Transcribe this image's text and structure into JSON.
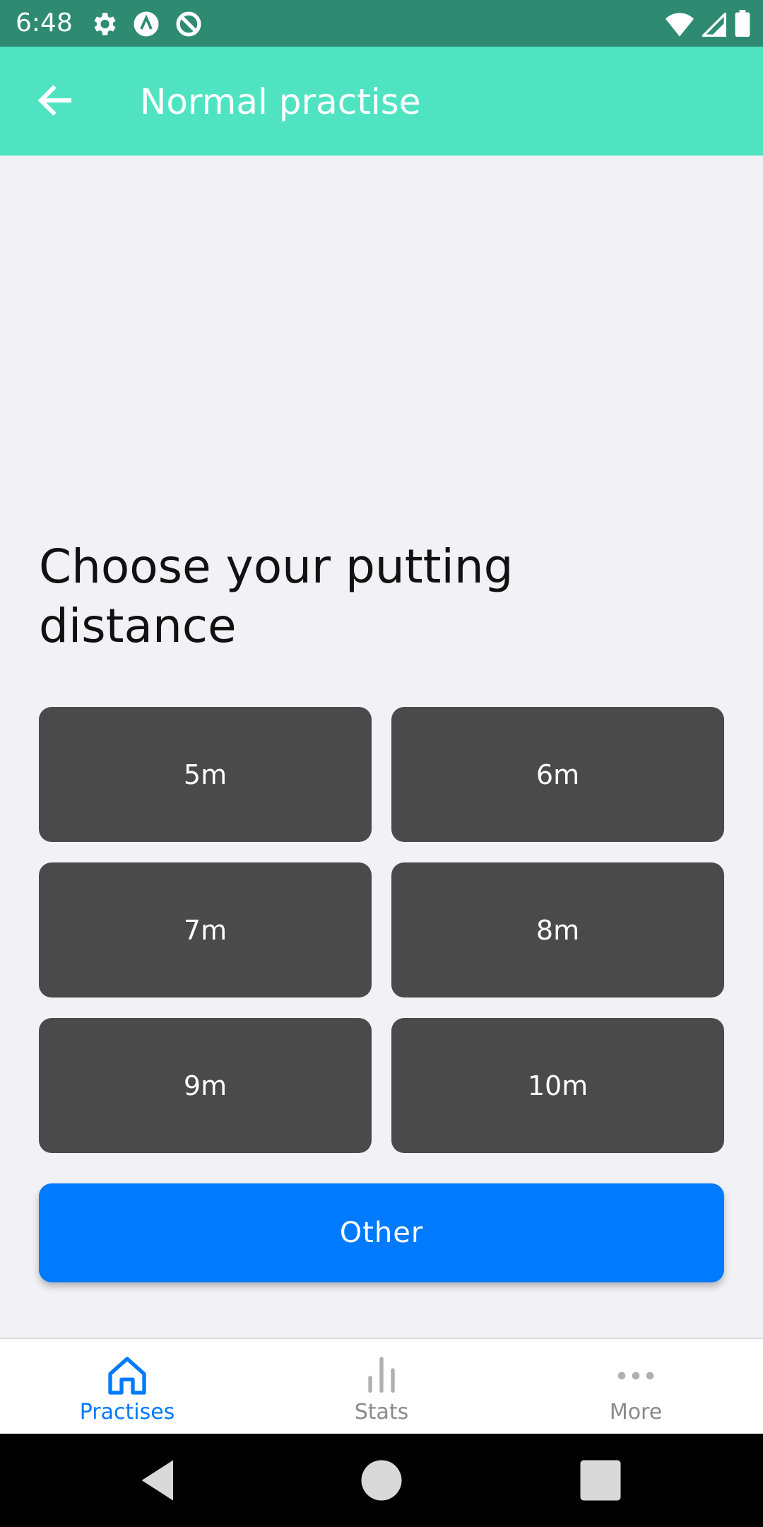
{
  "status_bar": {
    "time": "6:48",
    "left_icons": [
      "settings-icon",
      "a-circle-icon",
      "no-sync-icon"
    ],
    "right_icons": [
      "wifi-icon",
      "signal-icon",
      "battery-icon"
    ]
  },
  "header": {
    "title": "Normal practise",
    "back_icon": "arrow-left-icon",
    "background": "#50e3c2"
  },
  "main": {
    "heading": "Choose your putting distance",
    "distances": [
      "5m",
      "6m",
      "7m",
      "8m",
      "9m",
      "10m"
    ],
    "other_label": "Other",
    "button_color": "#4a4a4a",
    "accent": "#007aff"
  },
  "tabs": [
    {
      "label": "Practises",
      "icon": "home-icon",
      "active": true
    },
    {
      "label": "Stats",
      "icon": "bar-chart-icon",
      "active": false
    },
    {
      "label": "More",
      "icon": "more-dots-icon",
      "active": false
    }
  ],
  "nav": {
    "buttons": [
      "back-triangle-icon",
      "home-circle-icon",
      "recents-square-icon"
    ]
  }
}
